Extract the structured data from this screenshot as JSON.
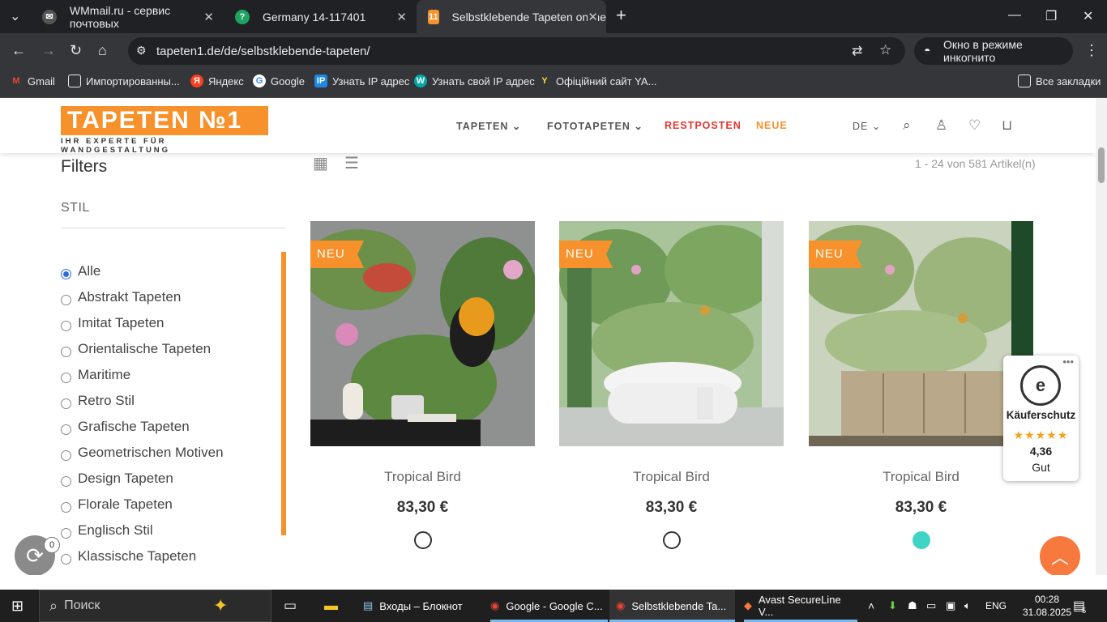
{
  "browser": {
    "tabs": [
      {
        "title": "WMmail.ru - сервис почтовых"
      },
      {
        "title": "Germany 14-117401"
      },
      {
        "title": "Selbstklebende Tapeten online"
      }
    ],
    "url": "tapeten1.de/de/selbstklebende-tapeten/",
    "incognito_label": "Окно в режиме инкогнито",
    "bookmarks": [
      {
        "label": "Gmail"
      },
      {
        "label": "Импортированны..."
      },
      {
        "label": "Яндекс"
      },
      {
        "label": "Google"
      },
      {
        "label": "Узнать IP адрес"
      },
      {
        "label": "Узнать свой IP адрес"
      },
      {
        "label": "Офіційний сайт YA..."
      }
    ],
    "all_bookmarks": "Все закладки"
  },
  "site": {
    "logo_text": "TAPETEN №1",
    "logo_subtitle": "IHR EXPERTE FÜR WANDGESTALTUNG",
    "nav": [
      {
        "label": "TAPETEN",
        "color": "#555555"
      },
      {
        "label": "FOTOTAPETEN",
        "color": "#555555"
      },
      {
        "label": "RESTPOSTEN",
        "color": "#e8352e"
      },
      {
        "label": "NEUE",
        "color": "#f7912c"
      }
    ],
    "language": "DE",
    "accent": "#f7912c"
  },
  "filters": {
    "title": "Filters",
    "section": "STIL",
    "items": [
      {
        "label": "Alle",
        "checked": true
      },
      {
        "label": "Abstrakt Tapeten"
      },
      {
        "label": "Imitat Tapeten"
      },
      {
        "label": "Orientalische Tapeten"
      },
      {
        "label": "Maritime"
      },
      {
        "label": "Retro Stil"
      },
      {
        "label": "Grafische Tapeten"
      },
      {
        "label": "Geometrischen Motiven"
      },
      {
        "label": "Design Tapeten"
      },
      {
        "label": "Florale Tapeten"
      },
      {
        "label": "Englisch Stil"
      },
      {
        "label": "Klassische Tapeten"
      }
    ]
  },
  "results_count": "1 - 24 von 581 Artikel(n)",
  "products": [
    {
      "badge": "NEU",
      "name": "Tropical Bird",
      "price": "83,30 €",
      "swatch": "#ffffff"
    },
    {
      "badge": "NEU",
      "name": "Tropical Bird",
      "price": "83,30 €",
      "swatch": "#ffffff"
    },
    {
      "badge": "NEU",
      "name": "Tropical Bird",
      "price": "83,30 €",
      "swatch": "#3fd4c6"
    }
  ],
  "trusted_shops": {
    "label": "Käuferschutz",
    "stars": "★★★★★",
    "score": "4,36",
    "rating": "Gut"
  },
  "sync_badge": "0",
  "taskbar": {
    "search": "Поиск",
    "apps": [
      {
        "label": "Входы – Блокнот"
      },
      {
        "label": "Google - Google C..."
      },
      {
        "label": "Selbstklebende Ta..."
      },
      {
        "label": "Avast SecureLine V..."
      }
    ],
    "lang": "ENG",
    "time": "00:28",
    "date": "31.08.2025",
    "notif": "5"
  }
}
